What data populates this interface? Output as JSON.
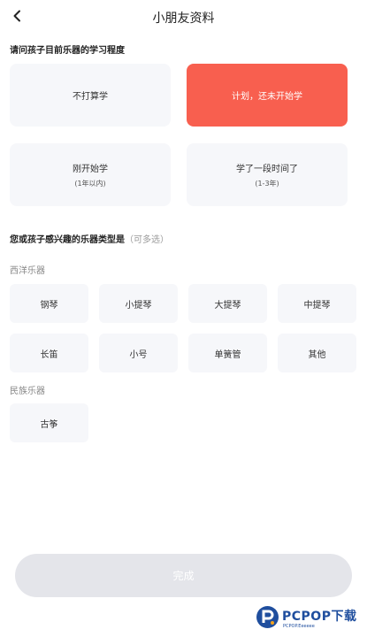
{
  "header": {
    "title": "小朋友资料"
  },
  "level_section": {
    "question": "请问孩子目前乐器的学习程度",
    "options": [
      {
        "label": "不打算学",
        "sub": "",
        "selected": false
      },
      {
        "label": "计划，还未开始学",
        "sub": "",
        "selected": true
      },
      {
        "label": "刚开始学",
        "sub": "(1年以内)",
        "selected": false
      },
      {
        "label": "学了一段时间了",
        "sub": "(1-3年)",
        "selected": false
      }
    ]
  },
  "interest_section": {
    "question": "您或孩子感兴趣的乐器类型是",
    "hint": "（可多选）",
    "western": {
      "label": "西洋乐器",
      "items": [
        "钢琴",
        "小提琴",
        "大提琴",
        "中提琴",
        "长笛",
        "小号",
        "单簧管",
        "其他"
      ]
    },
    "folk": {
      "label": "民族乐器",
      "items": [
        "古筝"
      ]
    }
  },
  "footer": {
    "done_label": "完成"
  },
  "watermark": {
    "brand": "PCPOP下载",
    "tagline": "PCPOP.Eeeeee"
  },
  "colors": {
    "accent": "#f85f4f",
    "chip_bg": "#f6f7fa",
    "button_disabled": "#e4e5ea",
    "watermark": "#1f4e9e"
  }
}
